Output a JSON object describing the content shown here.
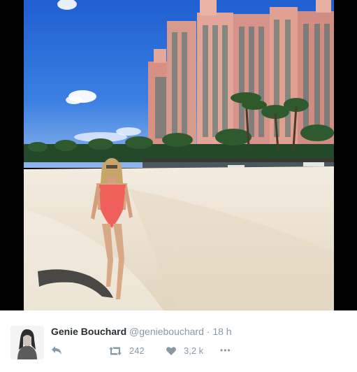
{
  "tweet": {
    "author_name": "Genie Bouchard",
    "handle": "@geniebouchard",
    "separator": "·",
    "time": "18 h",
    "retweet_count": "242",
    "like_count": "3,2 k",
    "more_label": "•••"
  },
  "icons": {
    "reply": "reply-icon",
    "retweet": "retweet-icon",
    "like": "heart-icon",
    "more": "more-icon"
  },
  "colors": {
    "name": "#292f33",
    "secondary": "#8899a6",
    "sky": "#2f6fd8",
    "hotel": "#d99a8e",
    "sand": "#eee4d3",
    "swimsuit": "#f0605a"
  }
}
